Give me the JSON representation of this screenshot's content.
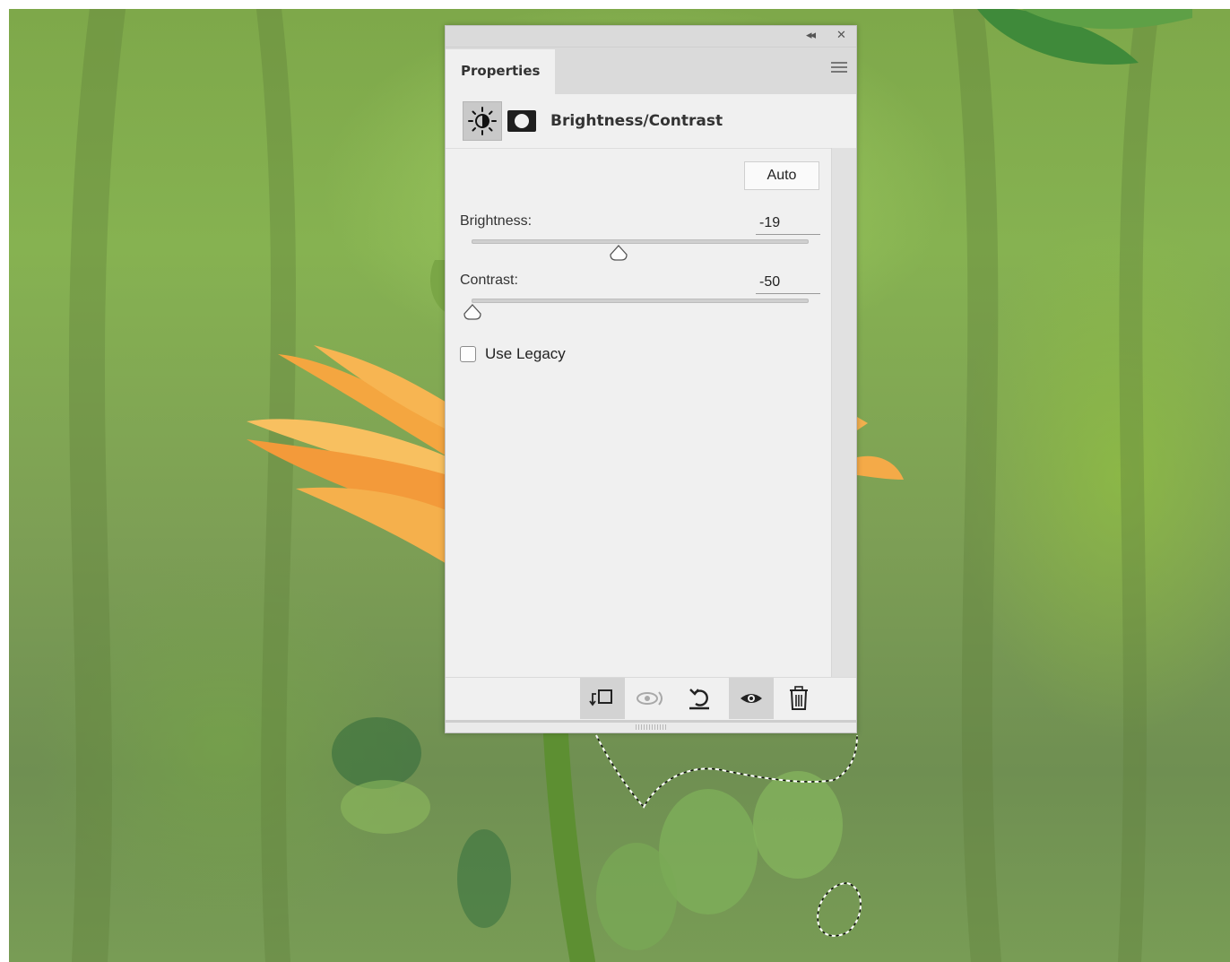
{
  "panel": {
    "tab_label": "Properties",
    "adjustment_title": "Brightness/Contrast",
    "auto_label": "Auto",
    "brightness": {
      "label": "Brightness:",
      "value": "-19",
      "min": -150,
      "max": 150
    },
    "contrast": {
      "label": "Contrast:",
      "value": "-50",
      "min": -50,
      "max": 100
    },
    "use_legacy": {
      "label": "Use Legacy",
      "checked": false
    },
    "titlebar_icons": [
      "collapse-icon",
      "close-icon"
    ],
    "footer_icons": [
      "clip-to-layer-icon",
      "view-previous-state-icon",
      "reset-icon",
      "visibility-eye-icon",
      "trash-icon"
    ]
  }
}
